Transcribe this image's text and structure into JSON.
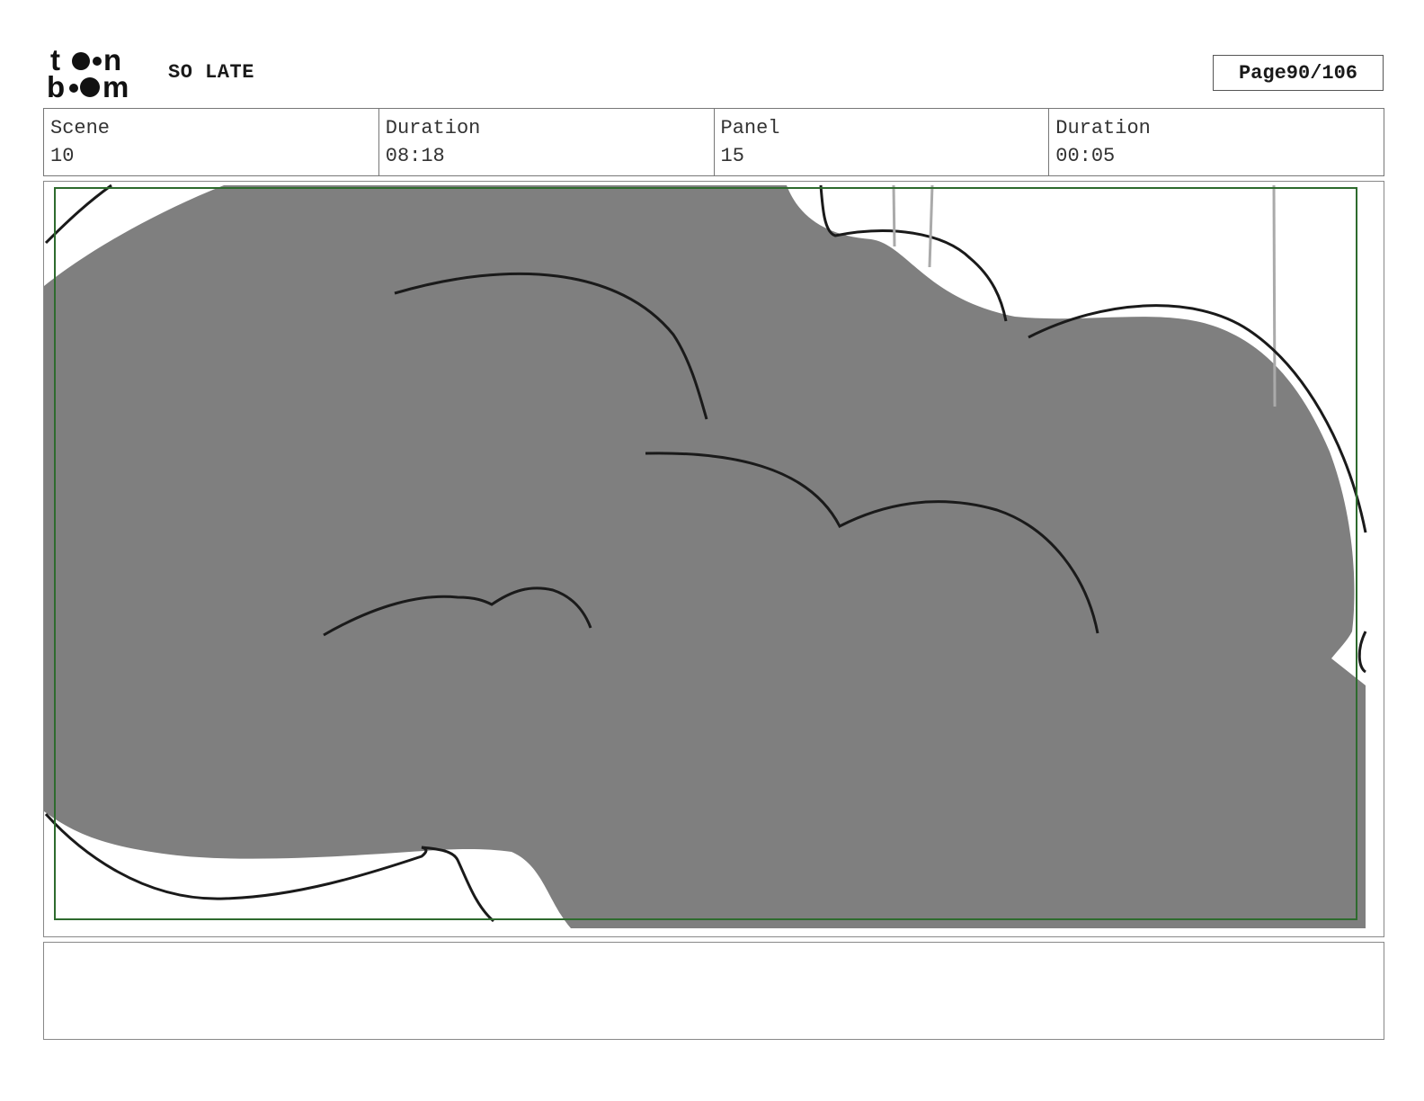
{
  "header": {
    "logo": {
      "text": "toon boom",
      "icon": "toon-boom-logo"
    },
    "project_title": "SO LATE",
    "page_label": "Page",
    "page_value": "90/106"
  },
  "info": [
    {
      "label": "Scene",
      "value": "10"
    },
    {
      "label": "Duration",
      "value": "08:18"
    },
    {
      "label": "Panel",
      "value": "15"
    },
    {
      "label": "Duration",
      "value": "00:05"
    }
  ],
  "panel": {
    "drawing": "storyboard-sketch-grey-cloud",
    "safe_frame_color": "#2e6b2e",
    "fill_color": "#7f7f7f"
  },
  "notes": {
    "text": ""
  }
}
